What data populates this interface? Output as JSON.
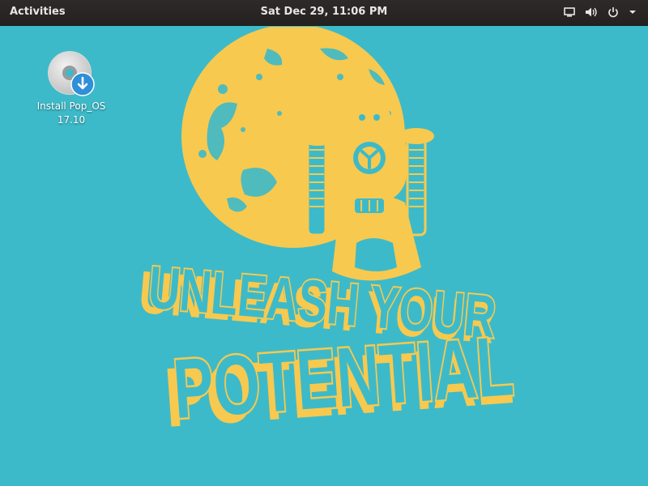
{
  "topbar": {
    "activities_label": "Activities",
    "clock_text": "Sat Dec 29, 11:06 PM",
    "tray_icons": [
      "display-icon",
      "volume-icon",
      "power-icon",
      "menu-arrow-icon"
    ]
  },
  "desktop": {
    "icons": [
      {
        "label_line1": "Install Pop_OS",
        "label_line2": "17.10",
        "icon": "disc-install-icon"
      }
    ]
  },
  "wallpaper": {
    "line1": "UNLEASH YOUR",
    "line2": "POTENTIAL",
    "colors": {
      "background": "#3dbac9",
      "art": "#f7c94f",
      "text_fill": "#3dbac9"
    }
  }
}
